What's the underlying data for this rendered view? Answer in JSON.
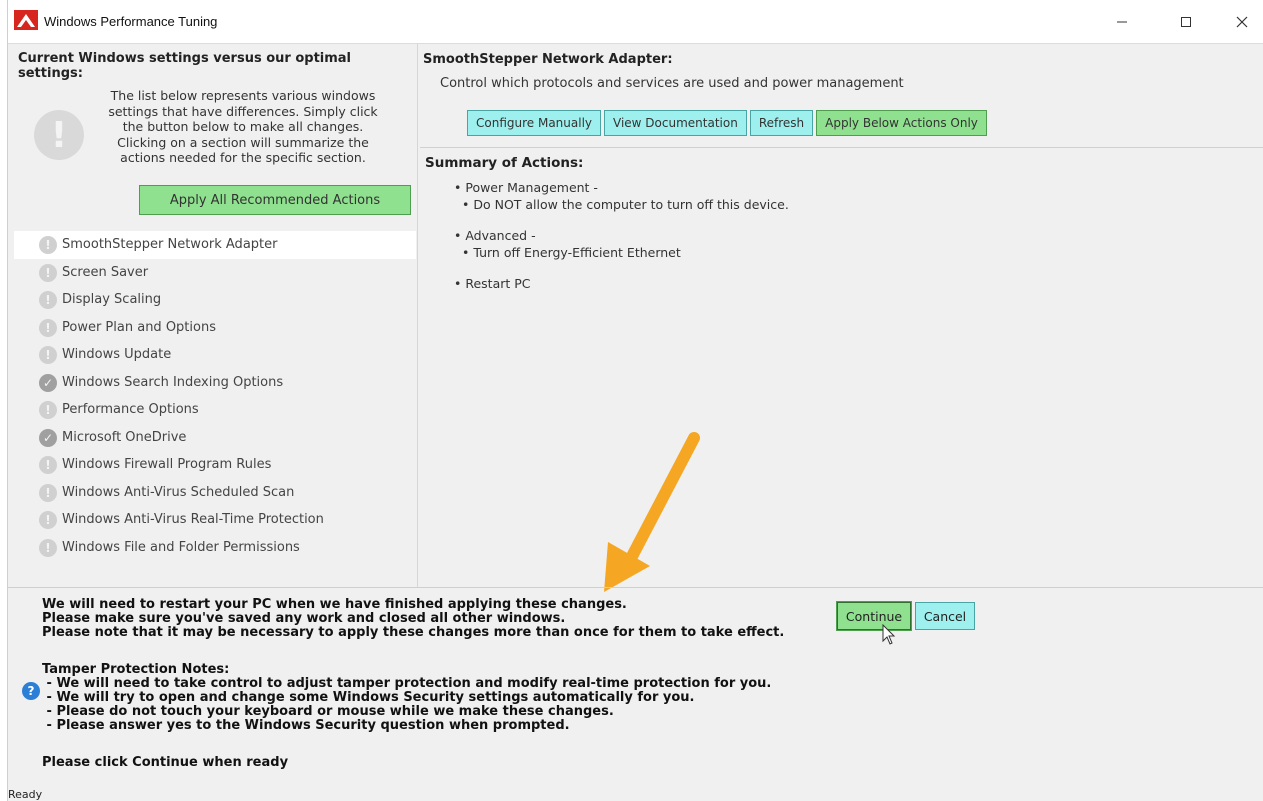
{
  "window": {
    "title": "Windows Performance Tuning",
    "min_icon": "minimize-icon",
    "max_icon": "maximize-icon",
    "close_icon": "close-icon"
  },
  "left": {
    "heading": "Current Windows settings versus our optimal settings:",
    "description": "The list below represents various windows settings that have differences. Simply click the button below to make all changes. Clicking on a section will summarize the actions needed for the specific section.",
    "apply_all_label": "Apply All Recommended Actions",
    "sections": [
      {
        "label": "SmoothStepper Network Adapter",
        "status": "exclamation",
        "selected": true
      },
      {
        "label": "Screen Saver",
        "status": "exclamation"
      },
      {
        "label": "Display Scaling",
        "status": "exclamation"
      },
      {
        "label": "Power Plan and Options",
        "status": "exclamation"
      },
      {
        "label": "Windows Update",
        "status": "exclamation"
      },
      {
        "label": "Windows Search Indexing Options",
        "status": "check"
      },
      {
        "label": "Performance Options",
        "status": "exclamation"
      },
      {
        "label": "Microsoft OneDrive",
        "status": "check"
      },
      {
        "label": "Windows Firewall Program Rules",
        "status": "exclamation"
      },
      {
        "label": "Windows Anti-Virus Scheduled Scan",
        "status": "exclamation"
      },
      {
        "label": "Windows Anti-Virus Real-Time Protection",
        "status": "exclamation"
      },
      {
        "label": "Windows File and Folder Permissions",
        "status": "exclamation"
      }
    ]
  },
  "right": {
    "adapter_title": "SmoothStepper Network Adapter:",
    "adapter_subtitle": "Control which protocols and services are used and power management",
    "buttons": {
      "configure": "Configure Manually",
      "documentation": "View Documentation",
      "refresh": "Refresh",
      "apply_below": "Apply Below Actions Only"
    },
    "summary_title": "Summary of Actions:",
    "summary": {
      "l1": "• Power Management -",
      "l2": "• Do NOT allow the computer to turn off this device.",
      "l3": "• Advanced -",
      "l4": "• Turn off Energy-Efficient Ethernet",
      "l5": "• Restart PC"
    }
  },
  "bottom": {
    "restart_1": "We will need to restart your PC when we have finished applying these changes.",
    "restart_2": "Please make sure you've saved any work and closed all other windows.",
    "restart_3": "Please note that it may be necessary to apply these changes more than once for them to take effect.",
    "tamper_title": "Tamper Protection Notes:",
    "tamper_1": " - We will need to take control to adjust tamper protection and modify real-time protection for you.",
    "tamper_2": " - We will try to open and change some Windows Security settings automatically for you.",
    "tamper_3": " - Please do not touch your keyboard or mouse while we make these changes.",
    "tamper_4": " - Please answer yes to the Windows Security question when prompted.",
    "click_continue": "Please click Continue when ready",
    "continue_label": "Continue",
    "cancel_label": "Cancel"
  },
  "status": {
    "text": "Ready"
  },
  "colors": {
    "green_button": "#8fe08f",
    "cyan_button": "#9ef0ee",
    "arrow": "#f5a623",
    "help_icon": "#2b7fd6"
  }
}
